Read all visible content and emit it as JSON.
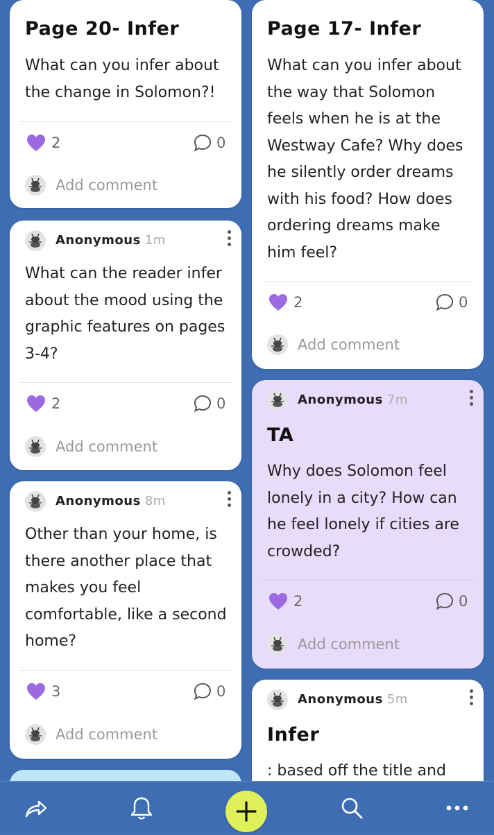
{
  "cards": {
    "c1": {
      "title": "Page 20- Infer",
      "body": "What can you infer about the change in Solomon?!",
      "likes": "2",
      "comments": "0",
      "add_comment": "Add comment"
    },
    "c2": {
      "author": "Anonymous",
      "time": "1m",
      "body": "What can the reader infer about the mood using the graphic features on pages 3-4?",
      "likes": "2",
      "comments": "0",
      "add_comment": "Add comment"
    },
    "c3": {
      "author": "Anonymous",
      "time": "8m",
      "body": "Other than your home, is there another place that makes you feel comfortable, like a second home?",
      "likes": "3",
      "comments": "0",
      "add_comment": "Add comment"
    },
    "c4": {
      "title": "Page 17- Infer",
      "body": "What can you infer about the way that Solomon feels when he is at the Westway Cafe? Why does he silently order dreams with his food? How does ordering dreams make him feel?",
      "likes": "2",
      "comments": "0",
      "add_comment": "Add comment"
    },
    "c5": {
      "author": "Anonymous",
      "time": "7m",
      "title": "TA",
      "body": "Why does Solomon feel lonely in a city? How can he feel lonely if cities are crowded?",
      "likes": "2",
      "comments": "0",
      "add_comment": "Add comment"
    },
    "c6": {
      "author": "Anonymous",
      "time": "5m",
      "title": "Infer",
      "body": ": based off the title and"
    }
  },
  "colors": {
    "background": "#3e6db3",
    "heart": "#9b6ae0",
    "purple_card": "#e8dcfb",
    "blue_card": "#bfe6f8",
    "plus_button": "#dff05a"
  },
  "icons": [
    "share-icon",
    "bell-icon",
    "plus-icon",
    "search-icon",
    "more-icon",
    "heart-icon",
    "comment-icon",
    "kebab-menu-icon"
  ]
}
